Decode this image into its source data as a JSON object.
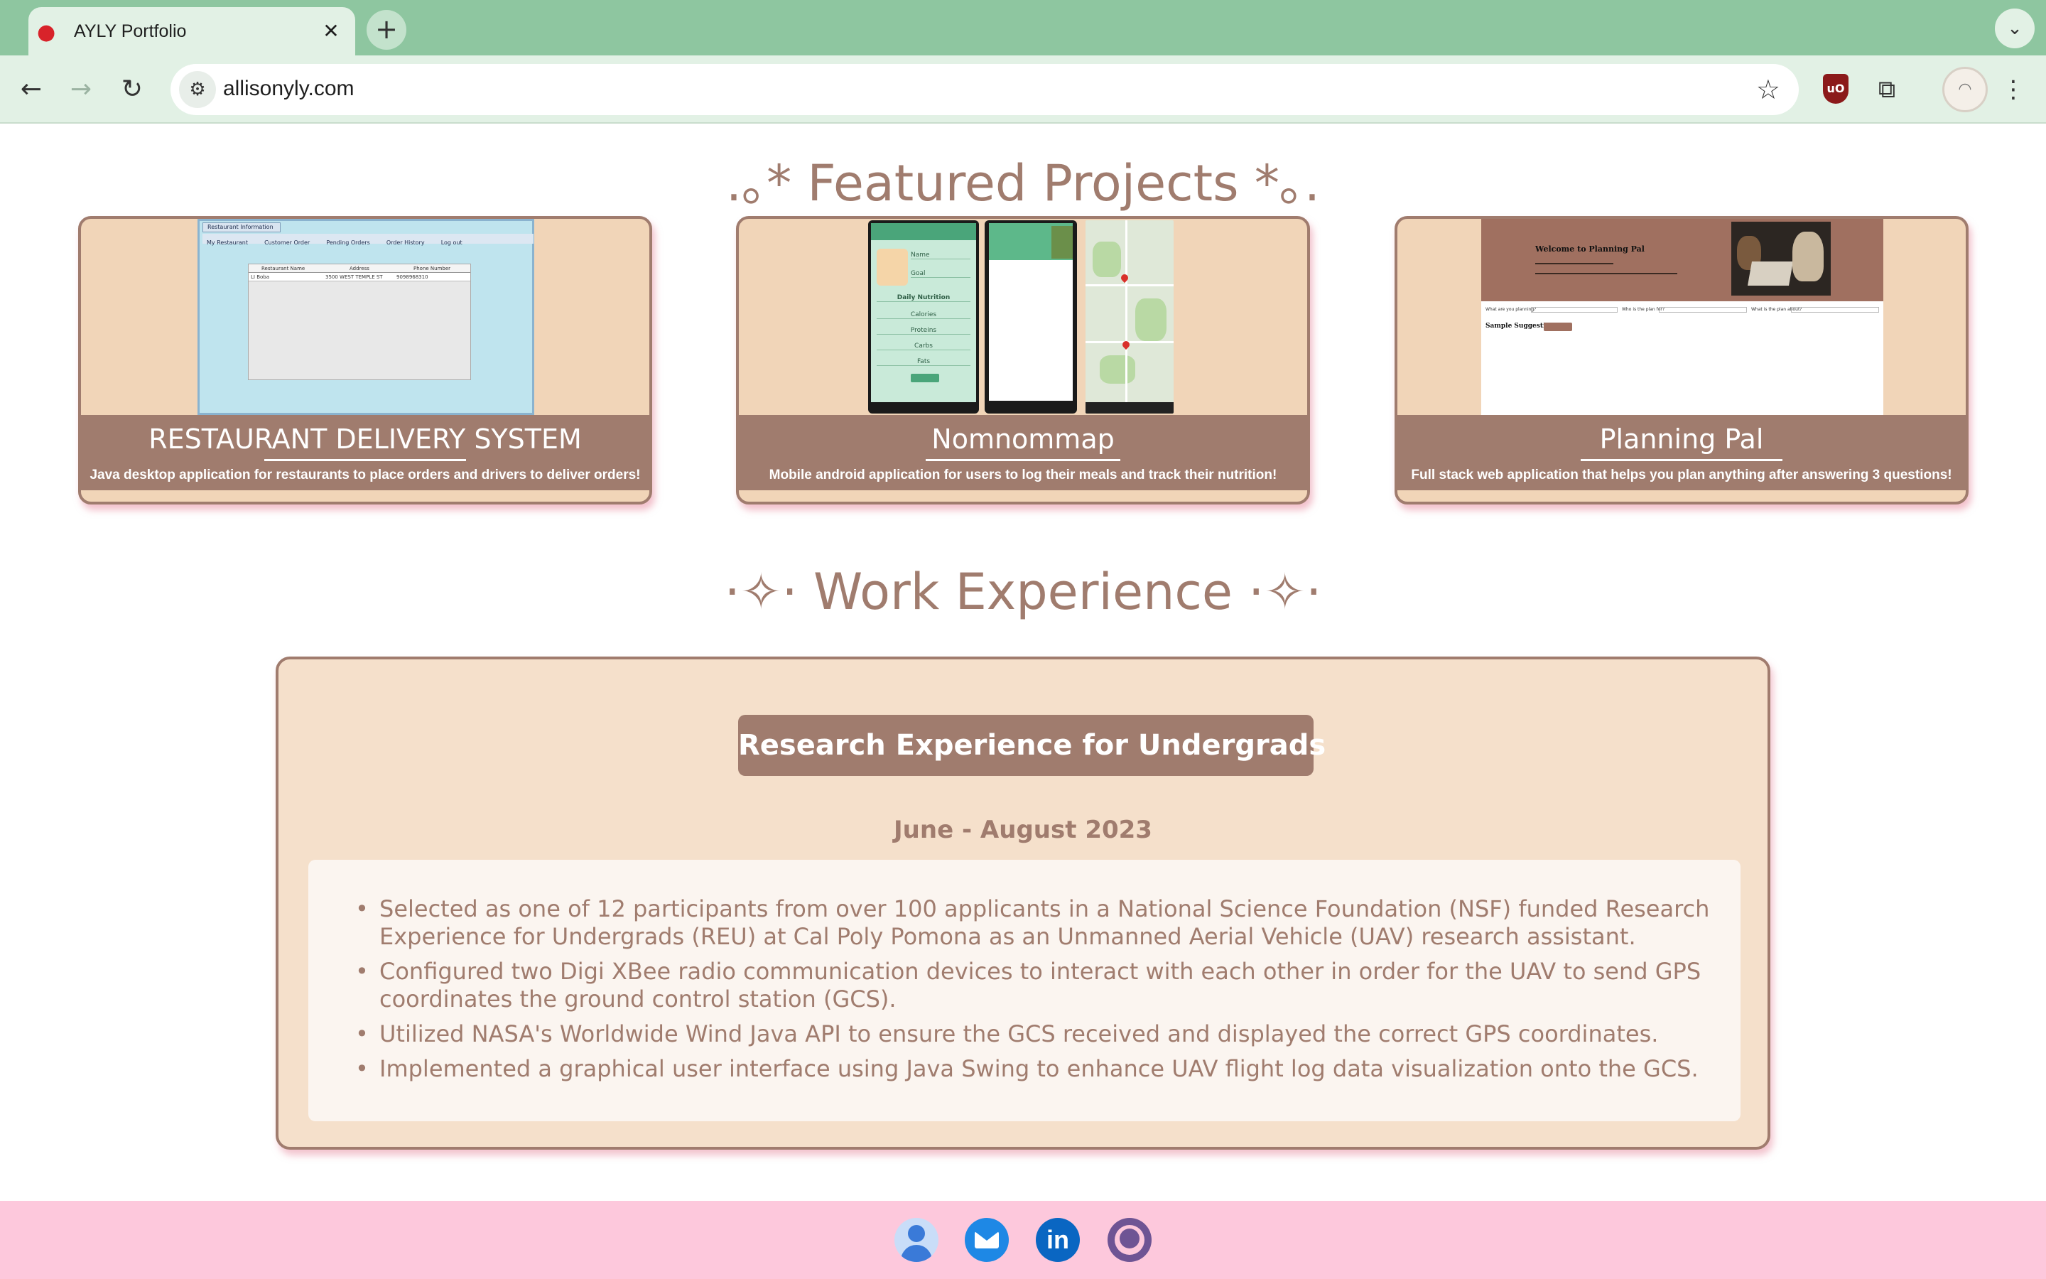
{
  "browser": {
    "tab_title": "AYLY Portfolio",
    "tab_favicon": "strawberry-icon",
    "tab_close": "✕",
    "new_tab": "+",
    "url": "allisonyly.com",
    "accent": "#8ec6a0"
  },
  "featured": {
    "title": ".｡* Featured Projects *｡.",
    "projects": [
      {
        "title": "RESTAURANT DELIVERY SYSTEM",
        "description": "Java desktop application for restaurants to place orders and drivers to deliver orders!"
      },
      {
        "title": "Nomnommap",
        "description": "Mobile android application for users to log their meals and track their nutrition!"
      },
      {
        "title": "Planning Pal",
        "description": "Full stack web application that helps you plan anything after answering 3 questions!"
      }
    ],
    "restaurant_screenshot": {
      "window_title": "Restaurant Information",
      "tabs": [
        "My Restaurant",
        "Customer Order",
        "Pending Orders",
        "Order History",
        "Log out"
      ],
      "columns": [
        "Restaurant Name",
        "Address",
        "Phone Number"
      ],
      "row": [
        "LI Boba",
        "3500 WEST TEMPLE ST",
        "9098968310"
      ]
    },
    "nomnommap_screenshot": {
      "labels": [
        "Name",
        "Goal",
        "Daily Nutrition",
        "Calories",
        "Proteins",
        "Carbs",
        "Fats"
      ]
    },
    "planningpal_screenshot": {
      "hero_title": "Welcome to Planning Pal",
      "form_labels": [
        "What are you planning?",
        "Who is the plan for?",
        "What is the plan about?"
      ],
      "sample_label": "Sample Suggestion"
    }
  },
  "work": {
    "title": "·✧· Work Experience ·✧·",
    "jobs": [
      {
        "title": "Research Experience for Undergrads",
        "dates": "June - August 2023",
        "bullets": [
          "Selected as one of 12 participants from over 100 applicants in a National Science Foundation (NSF) funded Research Experience for Undergrads (REU) at Cal Poly Pomona as an Unmanned Aerial Vehicle (UAV) research assistant.",
          "Configured two Digi XBee radio communication devices to interact with each other in order for the UAV to send GPS coordinates the ground control station (GCS).",
          "Utilized NASA's Worldwide Wind Java API to ensure the GCS received and displayed the correct GPS coordinates.",
          "Implemented a graphical user interface using Java Swing to enhance UAV flight log data visualization onto the GCS."
        ]
      }
    ]
  },
  "footer": {
    "icons": [
      "person-icon",
      "email-icon",
      "linkedin-icon",
      "github-icon"
    ],
    "linkedin_text": "in",
    "background": "#fdc8dc"
  },
  "colors": {
    "brand_brown": "#a07c6e",
    "card_bg": "#f1d5b8",
    "box_bg": "#f5e0cb"
  }
}
